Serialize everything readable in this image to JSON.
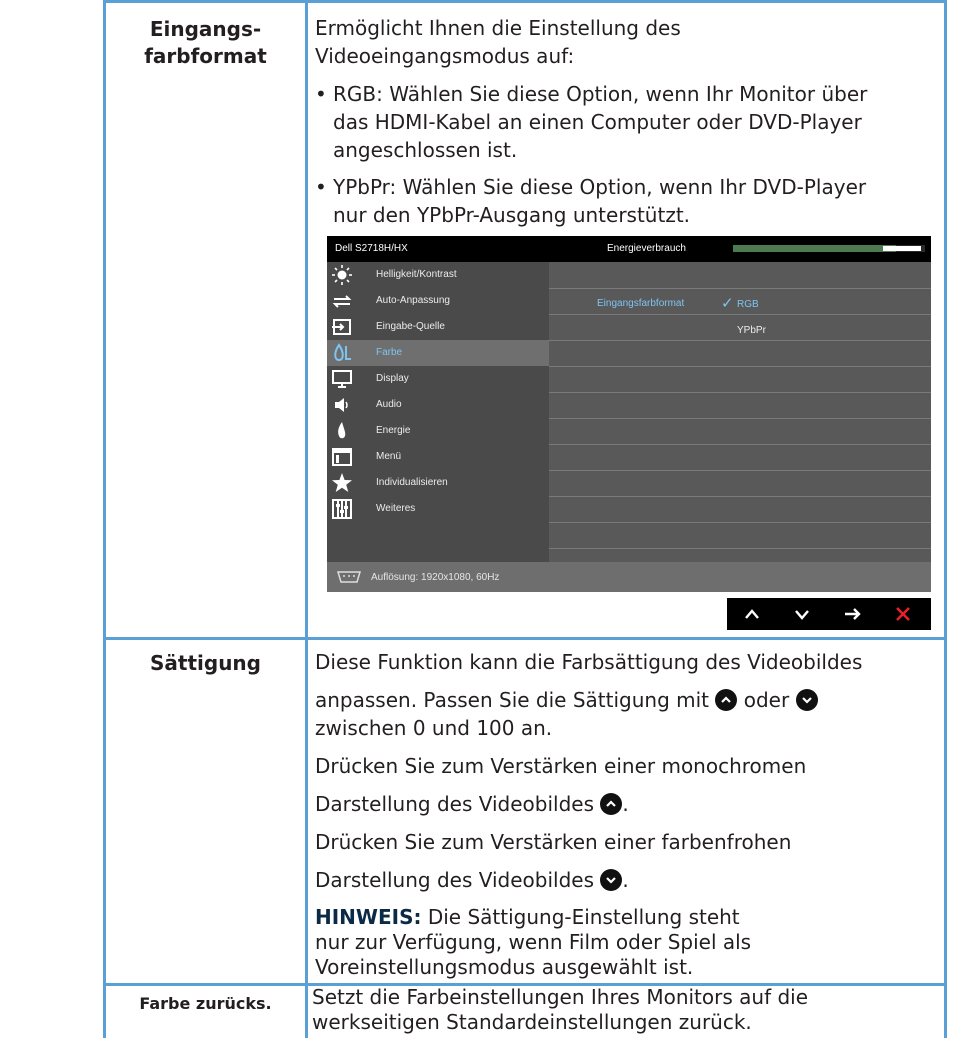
{
  "rows": [
    {
      "label_line1": "Eingangs-",
      "label_line2": "farbformat",
      "intro_line1": "Ermöglicht Ihnen die Einstellung des",
      "intro_line2": "Videoeingangsmodus auf:",
      "bullets": [
        {
          "line1": "RGB: Wählen Sie diese Option, wenn Ihr Monitor über",
          "line2": "das HDMI-Kabel an einen Computer oder DVD-Player",
          "line3": "angeschlossen ist."
        },
        {
          "line1": "YPbPr: Wählen Sie diese Option, wenn Ihr DVD-Player",
          "line2": "nur den YPbPr-Ausgang unterstützt."
        }
      ]
    },
    {
      "label": "Sättigung",
      "p1_line1": "Diese Funktion kann die Farbsättigung des Videobildes",
      "p1_line2a": "anpassen. Passen Sie die Sättigung mit",
      "p1_line2b": "oder",
      "p1_line3": "zwischen 0 und 100 an.",
      "p2_line1": "Drücken Sie zum Verstärken einer monochromen",
      "p2_line2": "Darstellung des Videobildes",
      "p3_line1": "Drücken Sie zum Verstärken einer farbenfrohen",
      "p3_line2": "Darstellung des Videobildes",
      "note_bold": "HINWEIS:",
      "note_line1": "Die Sättigung-Einstellung steht",
      "note_line2": "nur zur Verfügung, wenn Film oder Spiel als",
      "note_line3": "Voreinstellungsmodus ausgewählt ist."
    },
    {
      "label": "Farbe zurücks.",
      "line1": "Setzt die Farbeinstellungen Ihres Monitors auf die",
      "line2": "werkseitigen Standardeinstellungen zurück."
    }
  ],
  "osd": {
    "model": "Dell S2718H/HX",
    "energy_label": "Energieverbrauch",
    "energy_level": 0.85,
    "menu": [
      {
        "label": "Helligkeit/Kontrast",
        "icon": "brightness-icon"
      },
      {
        "label": "Auto-Anpassung",
        "icon": "auto-adjust-icon"
      },
      {
        "label": "Eingabe-Quelle",
        "icon": "input-source-icon"
      },
      {
        "label": "Farbe",
        "icon": "color-icon"
      },
      {
        "label": "Display",
        "icon": "display-icon"
      },
      {
        "label": "Audio",
        "icon": "audio-icon"
      },
      {
        "label": "Energie",
        "icon": "energy-icon"
      },
      {
        "label": "Menü",
        "icon": "menu-icon"
      },
      {
        "label": "Individualisieren",
        "icon": "star-icon"
      },
      {
        "label": "Weiteres",
        "icon": "others-icon"
      }
    ],
    "option_label": "Eingangsfarbformat",
    "option_values": [
      "RGB",
      "YPbPr"
    ],
    "selected": "RGB",
    "resolution": "Auflösung: 1920x1080, 60Hz"
  },
  "colors": {
    "rule": "#5aa0d4",
    "accent": "#7fc4f0",
    "energy_bar": "#4e7a52",
    "close": "#e8202a"
  }
}
